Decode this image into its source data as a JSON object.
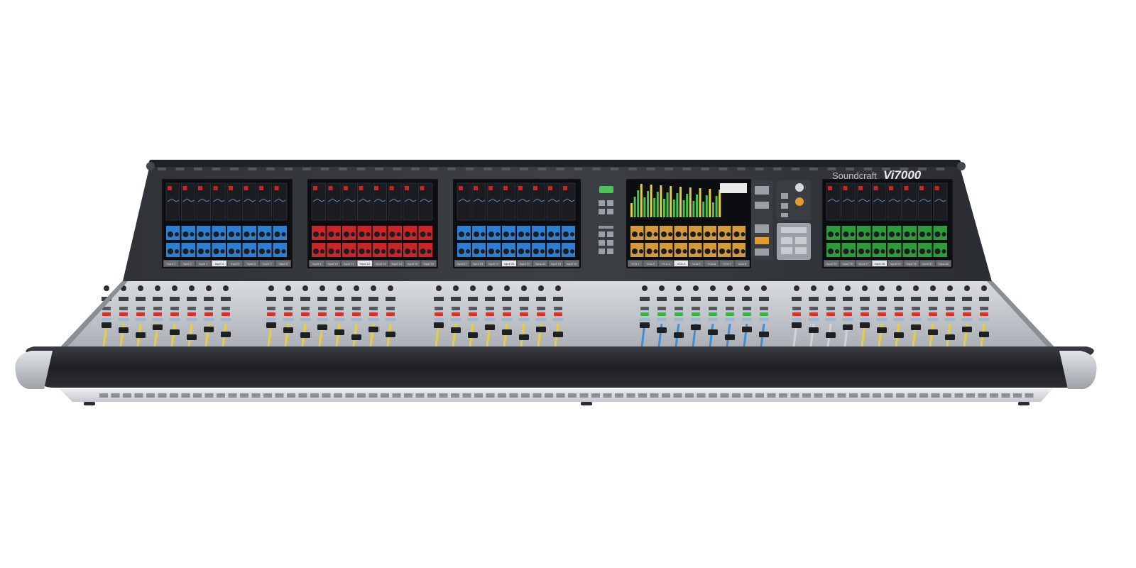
{
  "brand": {
    "maker": "Soundcraft",
    "model": "Vi7000"
  },
  "screens": [
    {
      "theme": "blue",
      "accent": "#2f7fd0",
      "tabs": [
        "Input 1",
        "Input 2",
        "Input 3",
        "Input 4",
        "Input 5",
        "Input 6",
        "Input 7",
        "Input 8"
      ]
    },
    {
      "theme": "red",
      "accent": "#c8262a",
      "tabs": [
        "Input 9",
        "Input 10",
        "Input 11",
        "Input 12",
        "Input 13",
        "Input 14",
        "Input 15",
        "Input 16"
      ]
    },
    {
      "theme": "blue",
      "accent": "#2f7fd0",
      "tabs": [
        "Input 17",
        "Input 18",
        "Input 19",
        "Input 20",
        "Input 21",
        "Input 22",
        "Input 23",
        "Input 24"
      ]
    },
    {
      "theme": "amber",
      "accent": "#d29a3c",
      "tabs": [
        "VCA 1",
        "VCA 2",
        "VCA 3",
        "VCA 4",
        "VCA 5",
        "VCA 6",
        "VCA 7",
        "VCA 8"
      ]
    },
    {
      "theme": "green",
      "accent": "#2e9a3c",
      "tabs": [
        "Input 25",
        "Input 26",
        "Input 27",
        "Input 28",
        "Input 29",
        "Input 30",
        "Input 31",
        "Input 32"
      ]
    }
  ],
  "colors": {
    "body": "#2a2c30",
    "deck": "#c9cdd2",
    "fader_yellow": "#e7cf3a",
    "fader_blue": "#3d8ed8",
    "led_red": "#d6302a",
    "led_green": "#3bb24a"
  }
}
